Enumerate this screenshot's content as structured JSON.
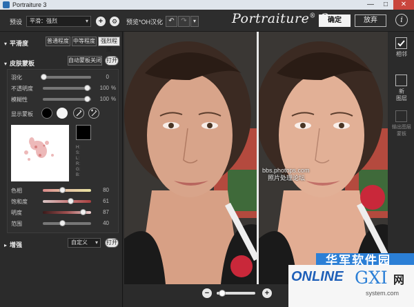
{
  "window": {
    "title": "Portraiture 3",
    "minimize": "—",
    "maximize": "□",
    "close": "✕"
  },
  "toolbar": {
    "preset_label": "预设",
    "preset_value": "平滑：强烈",
    "add": "+",
    "settings": "⚙",
    "preview_label": "预览",
    "chinese_note": "*OH汉化",
    "undo": "↶",
    "redo": "↷",
    "logo_text": "Portraiture",
    "logo_sup": "®",
    "logo_version": "3",
    "ok": "确定",
    "cancel": "放弃",
    "info": "i"
  },
  "smoothing": {
    "title": "平滑度",
    "normal": "普通程度",
    "medium": "中等程度",
    "strong": "强烈程度"
  },
  "skin_mask": {
    "title": "皮肤蒙板",
    "auto_mask": "自动蒙板关闭",
    "open": "打开",
    "sliders": [
      {
        "label": "羽化",
        "value": "0",
        "unit": "",
        "fraction": 0.0
      },
      {
        "label": "不透明度",
        "value": "100",
        "unit": "%",
        "fraction": 1.0
      },
      {
        "label": "模糊性",
        "value": "100",
        "unit": "%",
        "fraction": 1.0
      }
    ],
    "show_mask": "显示蒙板",
    "hsl_labels": [
      "H:",
      "S:",
      "L:",
      "R:",
      "G:",
      "B:"
    ],
    "color_sliders": [
      {
        "label": "色相",
        "value": "80",
        "fraction": 0.5
      },
      {
        "label": "饱和度",
        "value": "61",
        "fraction": 0.6
      },
      {
        "label": "明度",
        "value": "87",
        "fraction": 0.85
      },
      {
        "label": "范围",
        "value": "40",
        "fraction": 0.4
      }
    ]
  },
  "enhance": {
    "title": "增强",
    "custom": "自定义",
    "open": "打开"
  },
  "preview": {
    "watermark_1": "bbs.photops.com",
    "watermark_2": "照片处理论坛"
  },
  "rightbar": {
    "side_by_side": "相邻",
    "new_layer": "新\n图层",
    "output_mask": "输出图层\n蒙板"
  },
  "zoom": {
    "minus": "−",
    "plus": "+",
    "fraction": 0.1
  },
  "site_badge": {
    "cn": "华军软件园",
    "en": "ONLINE",
    "gxi": "GXI",
    "net": "网",
    "domain": "system.com"
  },
  "colors": {
    "accent_blue": "#2b7fd6",
    "close_red": "#c9463d"
  }
}
